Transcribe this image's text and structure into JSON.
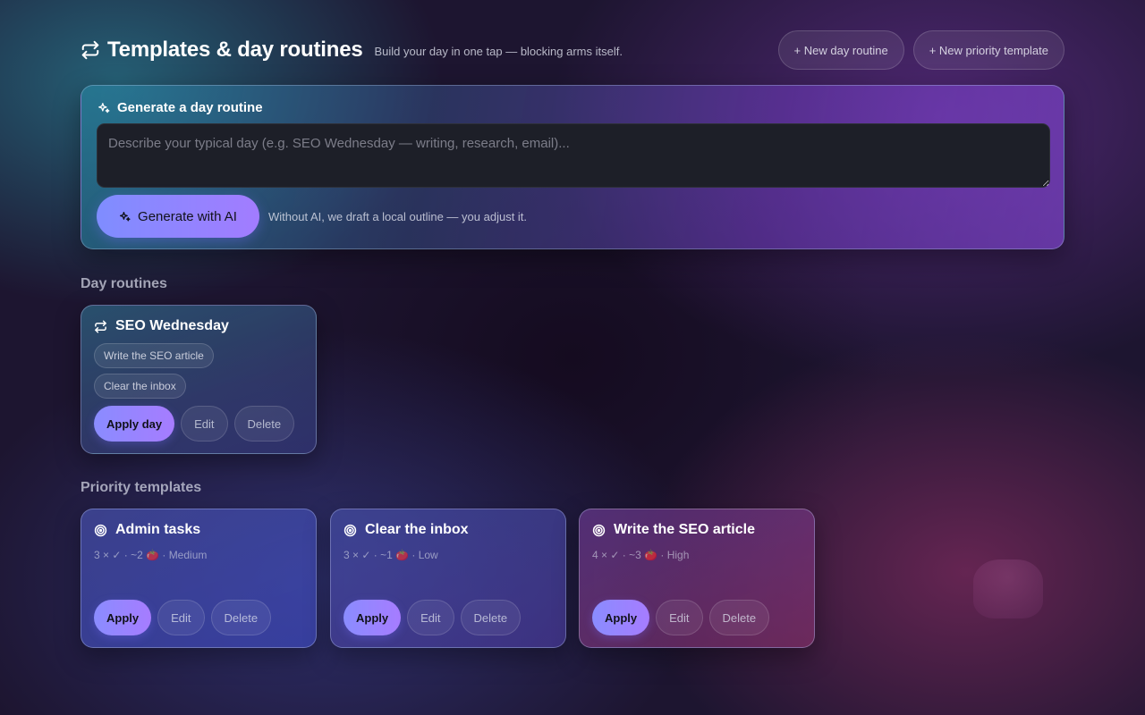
{
  "header": {
    "title": "Templates & day routines",
    "subtitle": "Build your day in one tap — blocking arms itself.",
    "new_day_routine": "+ New day routine",
    "new_priority_template": "+ New priority template"
  },
  "generator": {
    "title": "Generate a day routine",
    "placeholder": "Describe your typical day (e.g. SEO Wednesday — writing, research, email)...",
    "value": "",
    "button_label": "Generate with AI",
    "hint": "Without AI, we draft a local outline — you adjust it."
  },
  "day_routines": {
    "section_title": "Day routines",
    "items": [
      {
        "name": "SEO Wednesday",
        "priorities": [
          "Write the SEO article",
          "Clear the inbox"
        ],
        "apply_label": "Apply day",
        "edit_label": "Edit",
        "delete_label": "Delete"
      }
    ]
  },
  "priority_templates": {
    "section_title": "Priority templates",
    "items": [
      {
        "name": "Admin tasks",
        "meta": "3 × ✓ · ~2 🍅 · Medium",
        "apply_label": "Apply",
        "edit_label": "Edit",
        "delete_label": "Delete"
      },
      {
        "name": "Clear the inbox",
        "meta": "3 × ✓ · ~1 🍅 · Low",
        "apply_label": "Apply",
        "edit_label": "Edit",
        "delete_label": "Delete"
      },
      {
        "name": "Write the SEO article",
        "meta": "4 × ✓ · ~3 🍅 · High",
        "apply_label": "Apply",
        "edit_label": "Edit",
        "delete_label": "Delete"
      }
    ]
  },
  "colors": {
    "accent_start": "#7f8dff",
    "accent_end": "#a27cff"
  },
  "icons": {
    "title": "repeat-icon",
    "generator": "sparkles-icon",
    "routine": "repeat-icon",
    "template": "target-icon"
  }
}
